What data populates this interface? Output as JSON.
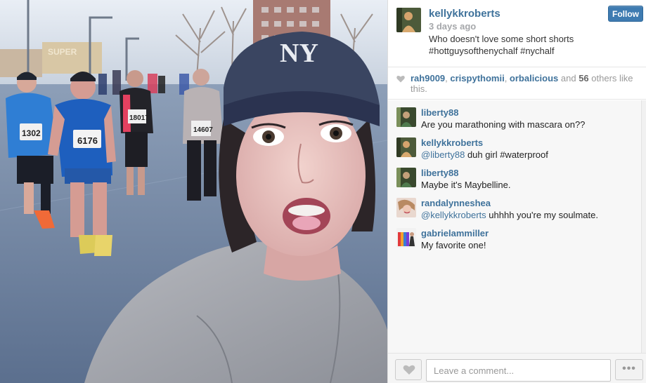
{
  "post": {
    "username": "kellykkroberts",
    "time_ago": "3 days ago",
    "caption_line1": "Who doesn't love some short shorts",
    "caption_line2": "#hottguysofthenychalf #nychalf",
    "follow_label": "Follow",
    "photo_text": {
      "cap_logo": "NY",
      "bib_1": "1302",
      "bib_2": "6176",
      "bib_3": "18017",
      "bib_4": "14607",
      "store_sign": "SUPER"
    }
  },
  "likes": {
    "user1": "rah9009",
    "sep1": ", ",
    "user2": "crispythomii",
    "sep2": ", ",
    "user3": "orbalicious",
    "and": " and ",
    "count": "56",
    "suffix": " others like this."
  },
  "comments": [
    {
      "user": "liberty88",
      "text": "Are you marathoning with mascara on??"
    },
    {
      "user": "kellykkroberts",
      "mention": "@liberty88",
      "text": " duh girl #waterproof"
    },
    {
      "user": "liberty88",
      "text": "Maybe it's Maybelline."
    },
    {
      "user": "randalynneshea",
      "mention": "@kellykkroberts",
      "text": " uhhhh you're my soulmate."
    },
    {
      "user": "gabrielammiller",
      "text": "My favorite one!"
    }
  ],
  "footer": {
    "comment_placeholder": "Leave a comment...",
    "more_label": "•••"
  },
  "colors": {
    "link_blue": "#3f729b",
    "follow_button": "#3e7bb1",
    "meta_gray": "#a5a7aa"
  },
  "icons": [
    "heart-icon",
    "more-dots-icon"
  ]
}
